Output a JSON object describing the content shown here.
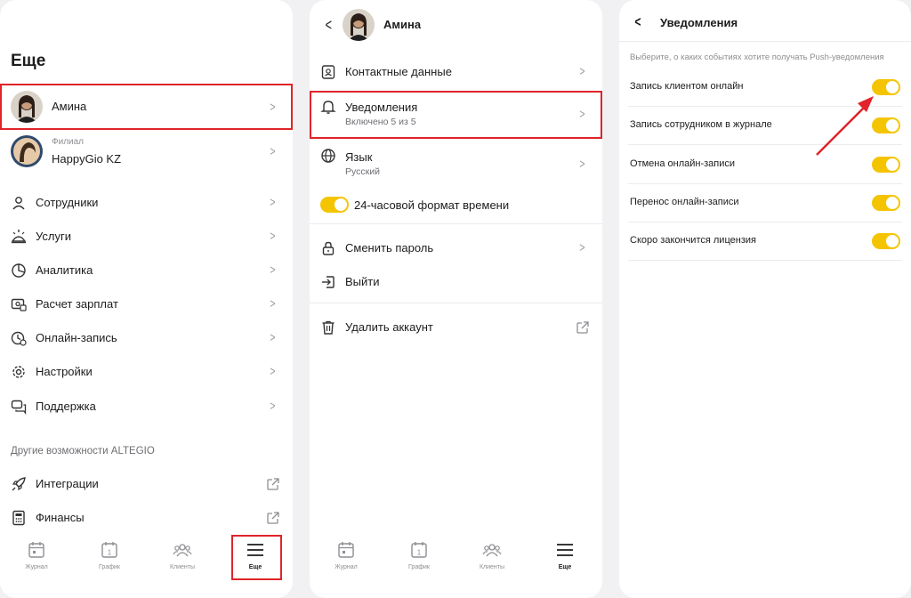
{
  "panel1": {
    "title": "Еще",
    "profile_name": "Амина",
    "branch_label": "Филиал",
    "branch_name": "HappyGio KZ",
    "menu": [
      {
        "label": "Сотрудники",
        "icon": "person-icon"
      },
      {
        "label": "Услуги",
        "icon": "services-icon"
      },
      {
        "label": "Аналитика",
        "icon": "pie-chart-icon"
      },
      {
        "label": "Расчет зарплат",
        "icon": "payroll-icon"
      },
      {
        "label": "Онлайн-запись",
        "icon": "online-booking-icon"
      },
      {
        "label": "Настройки",
        "icon": "gear-icon"
      },
      {
        "label": "Поддержка",
        "icon": "chat-icon"
      }
    ],
    "section_title": "Другие возможности ALTEGIO",
    "extra": [
      {
        "label": "Интеграции",
        "icon": "rocket-icon"
      },
      {
        "label": "Финансы",
        "icon": "calculator-icon"
      }
    ]
  },
  "nav": {
    "journal": "Журнал",
    "schedule": "График",
    "clients": "Клиенты",
    "more": "Еще"
  },
  "panel2": {
    "header_name": "Амина",
    "contacts": "Контактные данные",
    "notifications": "Уведомления",
    "notifications_sub": "Включено 5 из 5",
    "language": "Язык",
    "language_sub": "Русский",
    "time_format": "24-часовой формат времени",
    "change_password": "Сменить пароль",
    "logout": "Выйти",
    "delete_account": "Удалить аккаунт"
  },
  "panel3": {
    "title": "Уведомления",
    "hint": "Выберите, о каких событиях хотите получать Push-уведомления",
    "items": [
      {
        "label": "Запись клиентом онлайн",
        "on": true
      },
      {
        "label": "Запись сотрудником в журнале",
        "on": true
      },
      {
        "label": "Отмена онлайн-записи",
        "on": true
      },
      {
        "label": "Перенос онлайн-записи",
        "on": true
      },
      {
        "label": "Скоро закончится лицензия",
        "on": true
      }
    ]
  },
  "colors": {
    "accent_yellow": "#f5c400",
    "highlight_red": "#e0242a"
  }
}
